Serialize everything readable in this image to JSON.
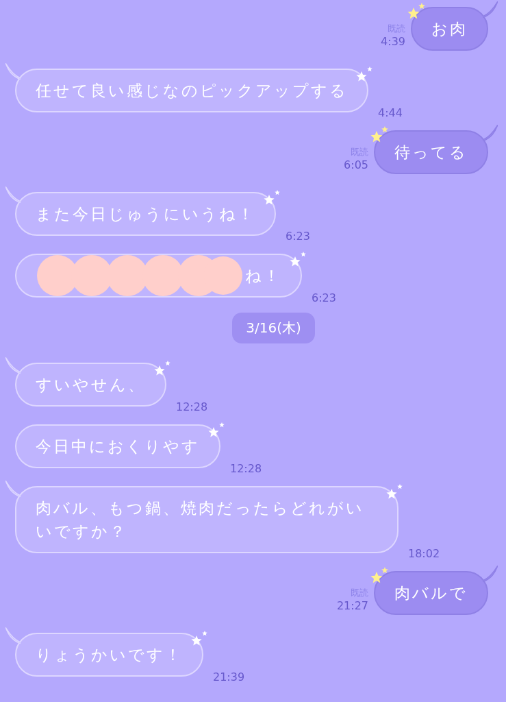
{
  "messages": [
    {
      "kind": "sent",
      "text": "お肉",
      "read_label": "既読",
      "time": "4:39"
    },
    {
      "kind": "received",
      "tail": true,
      "text": "任せて良い感じなのピックアップする",
      "time": "4:44"
    },
    {
      "kind": "sent",
      "text": "待ってる",
      "read_label": "既読",
      "time": "6:05"
    },
    {
      "kind": "received",
      "tail": true,
      "text": "また今日じゅうにいうね！",
      "time": "6:23"
    },
    {
      "kind": "received",
      "tail": false,
      "redacted": true,
      "text": "ね！",
      "time": "6:23"
    },
    {
      "kind": "date",
      "text": "3/16(木)"
    },
    {
      "kind": "received",
      "tail": true,
      "text": "すいやせん、",
      "time": "12:28"
    },
    {
      "kind": "received",
      "tail": false,
      "text": "今日中におくりやす",
      "time": "12:28"
    },
    {
      "kind": "received",
      "tail": true,
      "text": "肉バル、もつ鍋、焼肉だったらどれがいいですか？",
      "time": "18:02"
    },
    {
      "kind": "sent",
      "text": "肉バルで",
      "read_label": "既読",
      "time": "21:27"
    },
    {
      "kind": "received",
      "tail": true,
      "text": "りょうかいです！",
      "time": "21:39"
    }
  ]
}
